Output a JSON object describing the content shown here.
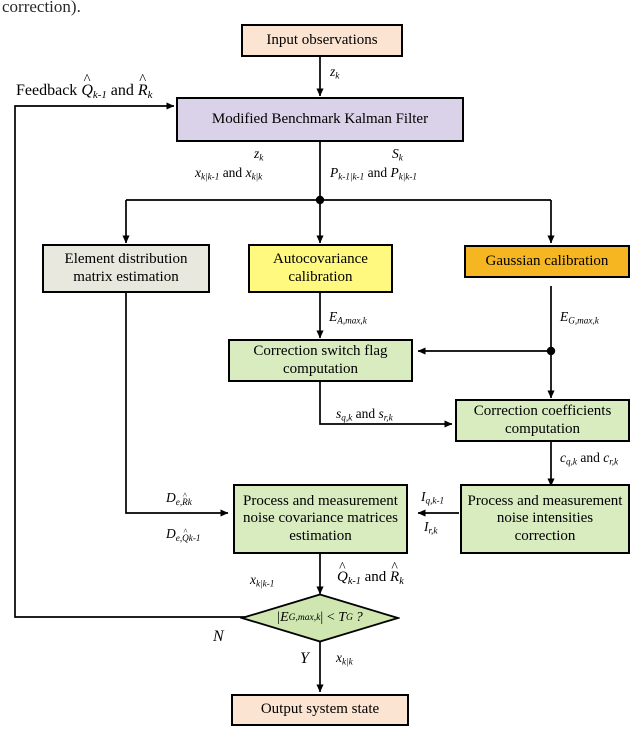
{
  "page": {
    "fragment_text": "correction).",
    "feedback_label": "Feedback Q̂k-1 and R̂k"
  },
  "colors": {
    "input_output": "#fbe5d2",
    "kalman": "#d9d2e9",
    "element_dist": "#e8e8de",
    "autocovariance": "#fff97f",
    "gaussian": "#f5b622",
    "green_process": "#d8ecc0",
    "diamond": "#cfe6b0",
    "stroke": "#000000"
  },
  "nodes": {
    "input_observations": "Input observations",
    "kalman_filter": "Modified Benchmark Kalman Filter",
    "element_distribution": "Element distribution matrix estimation",
    "autocovariance_calibration": "Autocovariance calibration",
    "gaussian_calibration": "Gaussian calibration",
    "correction_switch_flag": "Correction switch flag computation",
    "correction_coefficients": "Correction coefficients computation",
    "noise_covariance_estimation": "Process and measurement noise covariance matrices estimation",
    "noise_intensities_correction": "Process and measurement noise intensities correction",
    "decision": "|EG,max,k| < TG ?",
    "output_state": "Output system state"
  },
  "edge_labels": {
    "z_k_top": "zk",
    "z_k_left": "zk",
    "x_states_left": "xk|k-1 and xk|k",
    "s_k_right": "Sk",
    "p_states_right": "Pk-1|k-1 and Pk|k-1",
    "e_a_max": "EA,max,k",
    "e_g_max": "EG,max,k",
    "s_flags": "sq,k and sr,k",
    "c_coeffs": "cq,k and cr,k",
    "i_q": "Iq,k-1",
    "i_r": "Ir,k",
    "d_e_r": "De,R̂k",
    "d_e_q": "De,Q̂k-1",
    "x_pred": "xk|k-1",
    "qr_hat": "Q̂k-1 and R̂k",
    "branch_no": "N",
    "branch_yes": "Y",
    "x_post": "xk|k"
  }
}
